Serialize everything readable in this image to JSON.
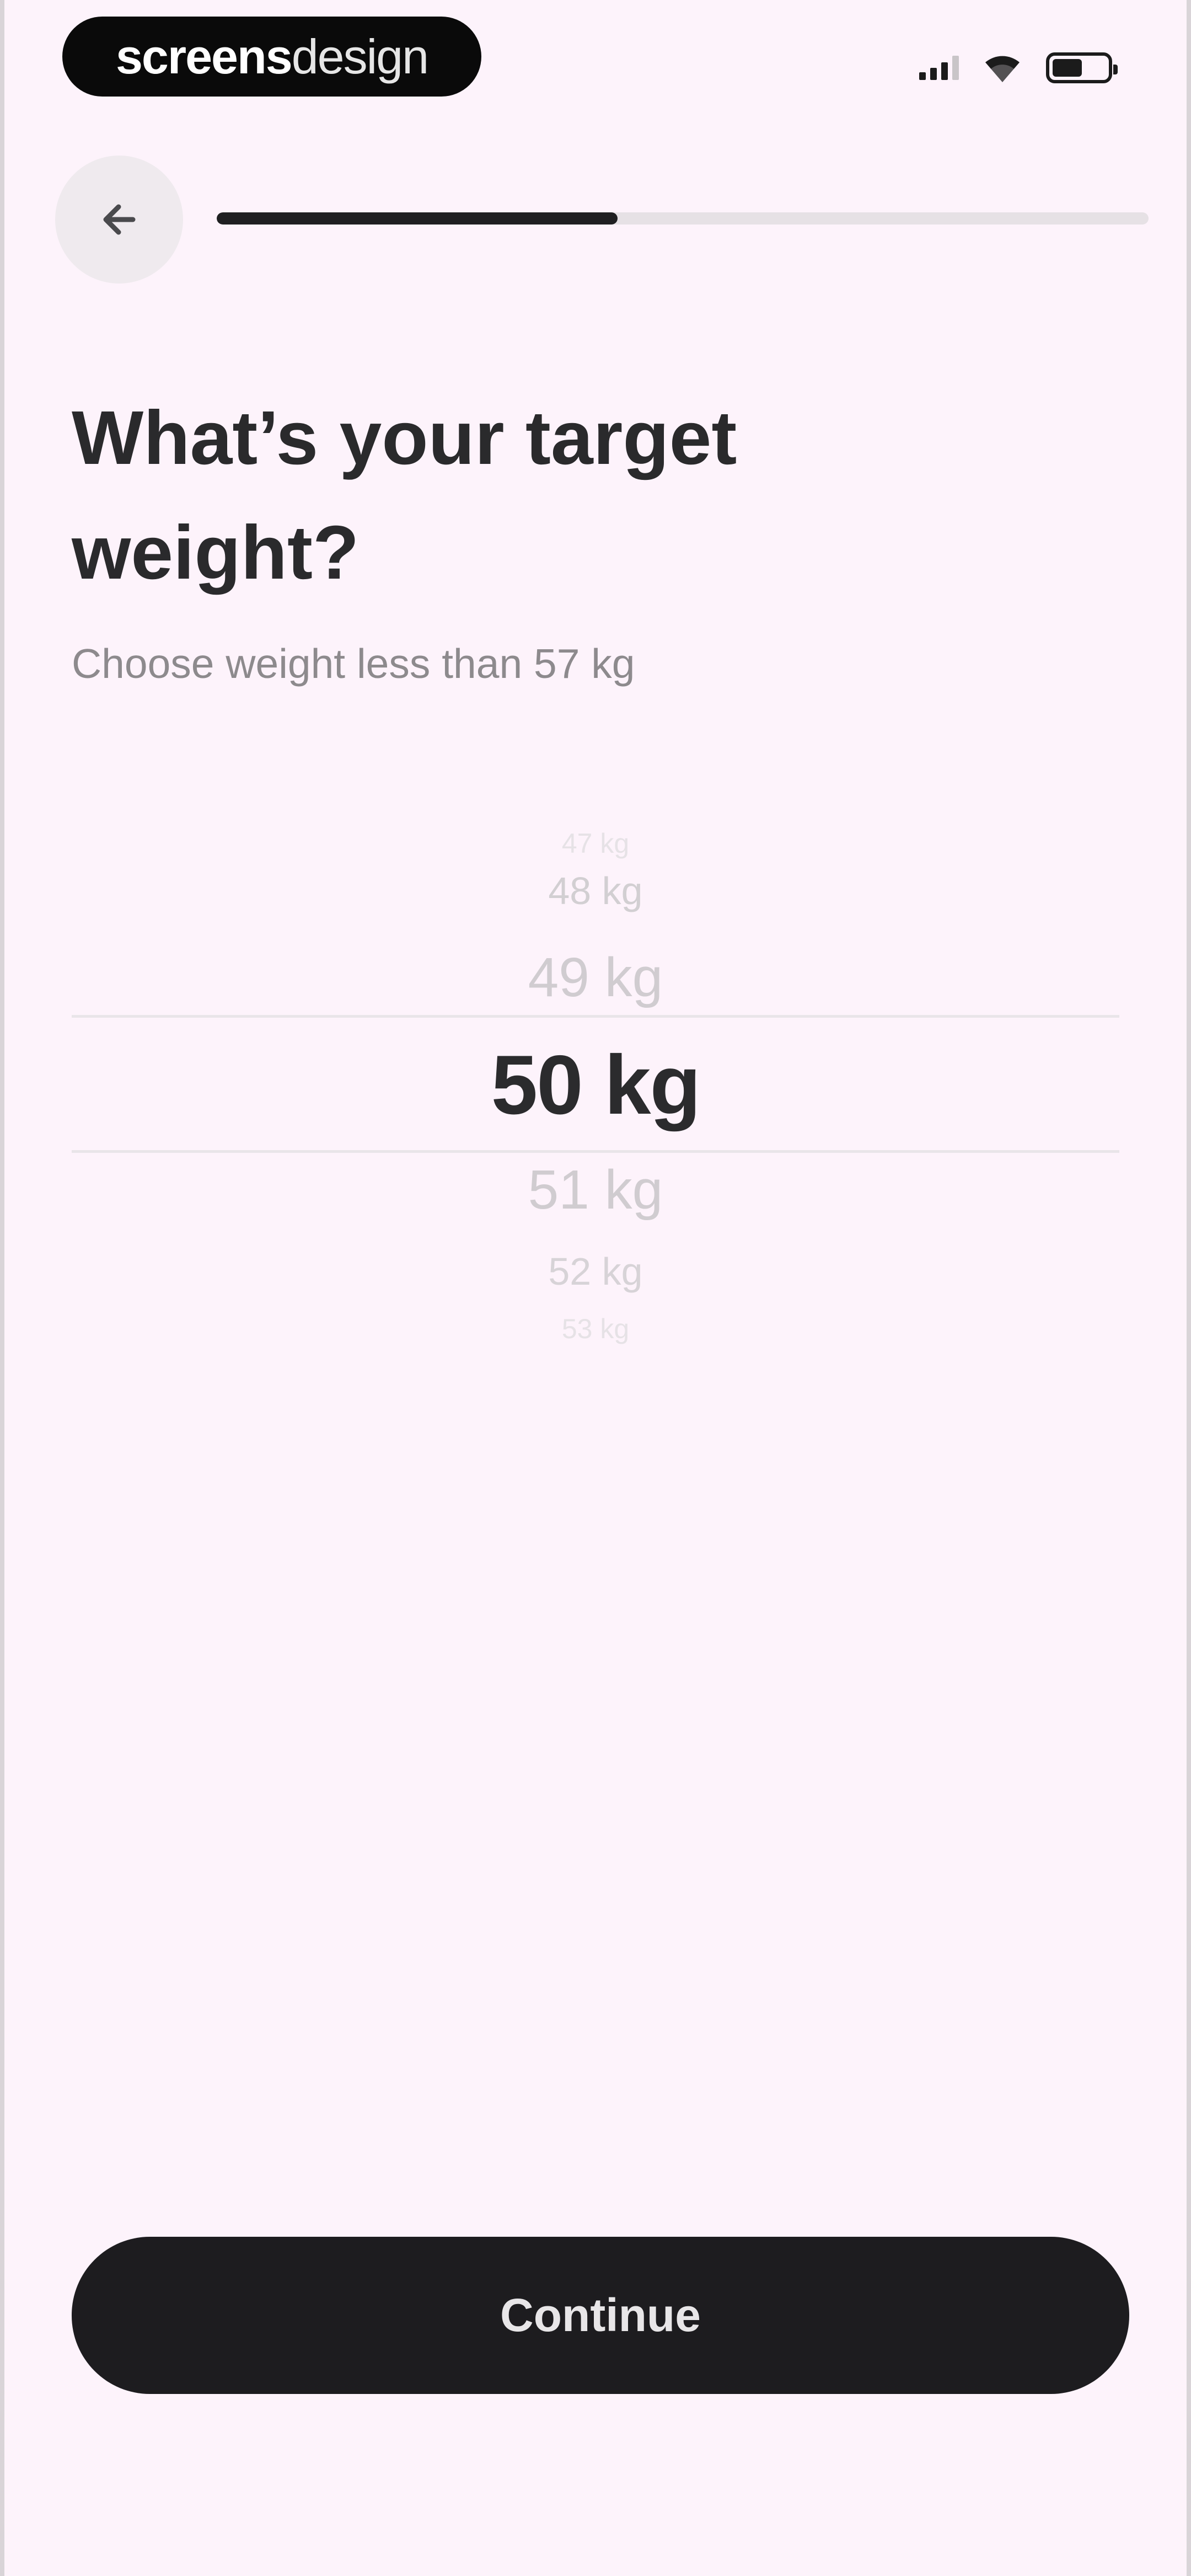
{
  "status_bar": {
    "brand_bold": "screens",
    "brand_light": "design",
    "battery_level": 0.55
  },
  "header": {
    "back_icon": "arrow-left-icon",
    "progress": 0.43
  },
  "question": {
    "title": "What’s your target weight?",
    "subtitle": "Choose weight less than 57 kg"
  },
  "picker": {
    "items": [
      "47 kg",
      "48 kg",
      "49 kg",
      "50 kg",
      "51 kg",
      "52 kg",
      "53 kg"
    ],
    "selected": "50 kg"
  },
  "footer": {
    "continue_label": "Continue"
  },
  "colors": {
    "background": "#fdf3fb",
    "primary": "#1d1c1f",
    "muted": "#8d8a8d"
  }
}
